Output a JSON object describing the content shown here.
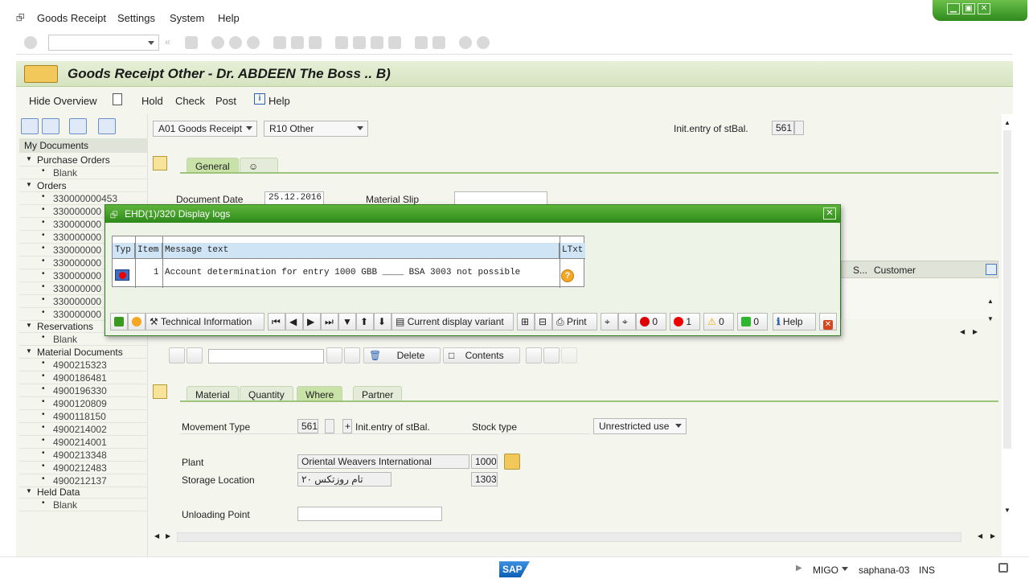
{
  "menu": [
    "Goods Receipt",
    "Settings",
    "System",
    "Help"
  ],
  "title": "Goods Receipt Other - Dr. ABDEEN The Boss .. B)",
  "app_toolbar": {
    "hide_overview": "Hide Overview",
    "hold": "Hold",
    "check": "Check",
    "post": "Post",
    "help": "Help"
  },
  "tree": {
    "header": "My Documents",
    "purchase_orders": "Purchase Orders",
    "blank": "Blank",
    "orders": "Orders",
    "orders_items": [
      "330000000453",
      "330000000",
      "330000000",
      "330000000",
      "330000000",
      "330000000",
      "330000000",
      "330000000",
      "330000000",
      "330000000"
    ],
    "reservations": "Reservations",
    "material_documents": "Material Documents",
    "material_items": [
      "4900215323",
      "4900186481",
      "4900196330",
      "4900120809",
      "4900118150",
      "4900214002",
      "4900214001",
      "4900213348",
      "4900212483",
      "4900212137"
    ],
    "held_data": "Held Data"
  },
  "header_fields": {
    "action": "A01 Goods Receipt",
    "reference": "R10 Other",
    "init_label": "Init.entry of stBal.",
    "init_value": "561"
  },
  "header_tabs": {
    "general": "General"
  },
  "general": {
    "doc_date_label": "Document Date",
    "doc_date_value": "25.12.2016",
    "material_slip_label": "Material Slip"
  },
  "items_table": {
    "col_s": "S...",
    "col_customer": "Customer"
  },
  "item_toolbar": {
    "delete": "Delete",
    "contents": "Contents"
  },
  "detail_tabs": [
    "Material",
    "Quantity",
    "Where",
    "Partner"
  ],
  "where": {
    "movement_type_label": "Movement Type",
    "movement_type": "561",
    "plus": "+",
    "init_text": "Init.entry of stBal.",
    "stock_type_label": "Stock type",
    "stock_type": "Unrestricted use",
    "plant_label": "Plant",
    "plant_name": "Oriental Weavers International",
    "plant_code": "1000",
    "storage_label": "Storage Location",
    "storage_name": "تام روزتكس ٢٠",
    "storage_code": "1303",
    "unloading_label": "Unloading Point"
  },
  "dialog": {
    "title": "EHD(1)/320 Display logs",
    "cols": {
      "typ": "Typ",
      "item": "Item",
      "msg": "Message text",
      "ltxt": "LTxt"
    },
    "row": {
      "item": "1",
      "msg": "Account determination for entry 1000 GBB ____ BSA 3003 not possible"
    },
    "buttons": {
      "tech": "Technical Information",
      "variant": "Current display variant",
      "print": "Print",
      "stop": "0",
      "error": "1",
      "warn": "0",
      "ok": "0",
      "help": "Help"
    }
  },
  "status": {
    "tcode": "MIGO",
    "server": "saphana-03",
    "mode": "INS",
    "logo": "SAP"
  }
}
